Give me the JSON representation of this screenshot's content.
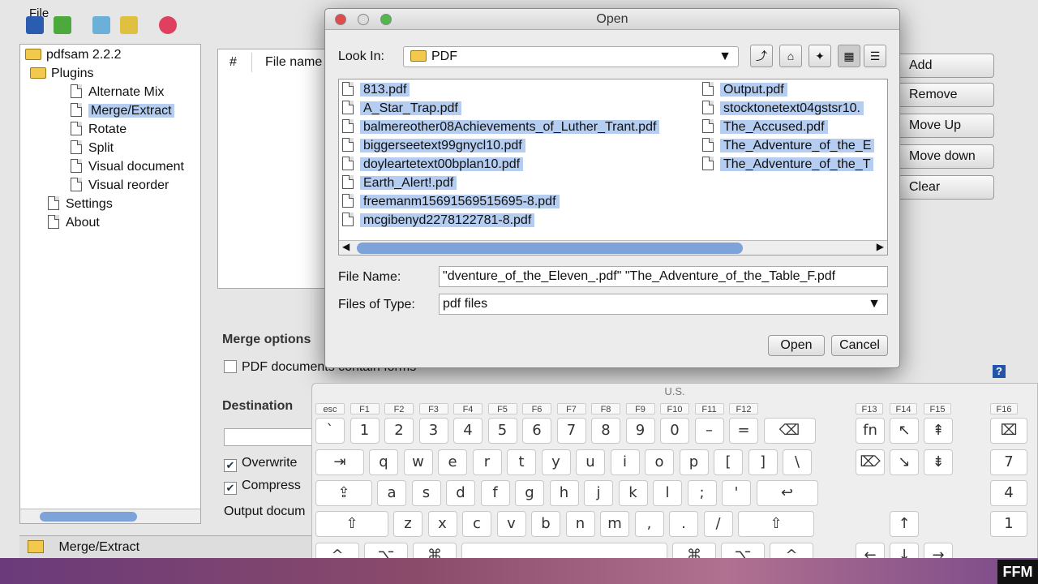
{
  "app": {
    "menu_file": "File",
    "tree": {
      "root": "pdfsam 2.2.2",
      "plugins": "Plugins",
      "items": [
        "Alternate Mix",
        "Merge/Extract",
        "Rotate",
        "Split",
        "Visual document",
        "Visual reorder"
      ],
      "settings": "Settings",
      "about": "About"
    },
    "table_headers": [
      "#",
      "File name"
    ],
    "buttons": {
      "add": "Add",
      "remove": "Remove",
      "move_up": "Move Up",
      "move_down": "Move down",
      "clear": "Clear"
    },
    "merge_options": "Merge options",
    "pdf_forms": "PDF documents contain forms",
    "destination": "Destination",
    "overwrite": "Overwrite",
    "compress": "Compress",
    "output_doc": "Output docum",
    "status": "Merge/Extract",
    "help": "?"
  },
  "dialog": {
    "title": "Open",
    "look_in_label": "Look In:",
    "look_in_value": "PDF",
    "files_col1": [
      "813.pdf",
      "A_Star_Trap.pdf",
      "balmereother08Achievements_of_Luther_Trant.pdf",
      "biggerseetext99gnycl10.pdf",
      "doyleartetext00bplan10.pdf",
      "Earth_Alert!.pdf",
      "freemanm15691569515695-8.pdf",
      "mcgibenyd2278122781-8.pdf"
    ],
    "files_col2": [
      "Output.pdf",
      "stocktonetext04gstsr10.",
      "The_Accused.pdf",
      "The_Adventure_of_the_E",
      "The_Adventure_of_the_T"
    ],
    "file_name_label": "File Name:",
    "file_name_value": "dventure_of_the_Eleven_.pdf\" \"The_Adventure_of_the_Table_F.pdf\"",
    "file_type_label": "Files of Type:",
    "file_type_value": "pdf files",
    "open": "Open",
    "cancel": "Cancel"
  },
  "keyboard": {
    "title": "U.S.",
    "fkeys": [
      "esc",
      "F1",
      "F2",
      "F3",
      "F4",
      "F5",
      "F6",
      "F7",
      "F8",
      "F9",
      "F10",
      "F11",
      "F12"
    ],
    "fkeys_right": [
      "F13",
      "F14",
      "F15",
      "F16"
    ],
    "row1": [
      "`",
      "1",
      "2",
      "3",
      "4",
      "5",
      "6",
      "7",
      "8",
      "9",
      "0",
      "–",
      "=",
      "⌫"
    ],
    "row2": [
      "⇥",
      "q",
      "w",
      "e",
      "r",
      "t",
      "y",
      "u",
      "i",
      "o",
      "p",
      "[",
      "]",
      "\\"
    ],
    "row3": [
      "⇪",
      "a",
      "s",
      "d",
      "f",
      "g",
      "h",
      "j",
      "k",
      "l",
      ";",
      "'",
      "↩"
    ],
    "row4": [
      "⇧",
      "z",
      "x",
      "c",
      "v",
      "b",
      "n",
      "m",
      ",",
      ".",
      "/",
      "⇧"
    ],
    "row5": [
      "^",
      "⌥",
      "⌘",
      "",
      "⌘",
      "⌥",
      "^"
    ],
    "nav1": [
      "fn",
      "↖",
      "⇞"
    ],
    "nav2": [
      "⌦",
      "↘",
      "⇟"
    ],
    "arrows": [
      "↑",
      "←",
      "↓",
      "→"
    ],
    "numpad": [
      "⌧",
      "7",
      "4",
      "1"
    ]
  },
  "watermark": "FFM"
}
